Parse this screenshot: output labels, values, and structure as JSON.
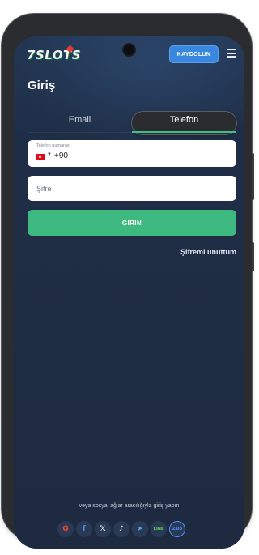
{
  "header": {
    "logo_text": "7SLOTS",
    "register_label": "KAYDOLUN"
  },
  "page": {
    "title": "Giriş"
  },
  "tabs": [
    {
      "label": "Email",
      "active": false
    },
    {
      "label": "Telefon",
      "active": true
    }
  ],
  "form": {
    "phone_label": "Telefon numarası",
    "phone_prefix": "+90",
    "password_placeholder": "Şifre",
    "submit_label": "GİRİN",
    "forgot_label": "Şifremi unuttum"
  },
  "social": {
    "caption": "veya sosyal ağlar aracılığıyla giriş yapın",
    "icons": [
      {
        "name": "google-icon",
        "glyph": "G"
      },
      {
        "name": "facebook-icon",
        "glyph": "f"
      },
      {
        "name": "x-icon",
        "glyph": "𝕏"
      },
      {
        "name": "tiktok-icon",
        "glyph": "♪"
      },
      {
        "name": "telegram-icon",
        "glyph": "➤"
      },
      {
        "name": "line-icon",
        "glyph": "LINE"
      },
      {
        "name": "zalo-icon",
        "glyph": "Zalo"
      }
    ]
  },
  "colors": {
    "accent_green": "#3eb97f",
    "register_blue": "#3a87e0",
    "screen_bg": "#1f2e47"
  }
}
